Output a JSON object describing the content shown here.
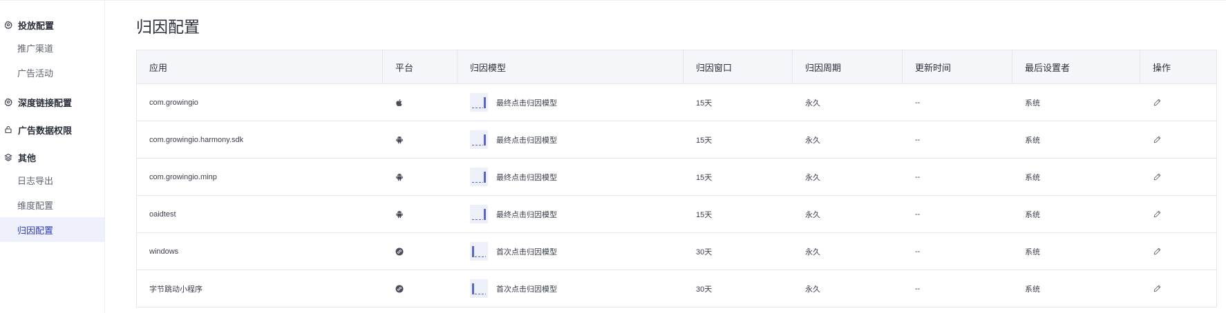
{
  "sidebar": {
    "groups": [
      {
        "icon": "gear-icon",
        "label": "投放配置",
        "items": [
          "推广渠道",
          "广告活动"
        ]
      },
      {
        "icon": "gear-icon",
        "label": "深度链接配置",
        "items": []
      },
      {
        "icon": "lock-icon",
        "label": "广告数据权限",
        "items": []
      },
      {
        "icon": "layers-icon",
        "label": "其他",
        "items": [
          "日志导出",
          "维度配置",
          "归因配置"
        ]
      }
    ],
    "active_item": "归因配置"
  },
  "page": {
    "title": "归因配置"
  },
  "table": {
    "headers": [
      "应用",
      "平台",
      "归因模型",
      "归因窗口",
      "归因周期",
      "更新时间",
      "最后设置者",
      "操作"
    ],
    "rows": [
      {
        "app": "com.growingio",
        "platform": "apple-icon",
        "model": "最终点击归因模型",
        "model_type": "last",
        "window": "15天",
        "period": "永久",
        "updated": "--",
        "setter": "系统"
      },
      {
        "app": "com.growingio.harmony.sdk",
        "platform": "android-icon",
        "model": "最终点击归因模型",
        "model_type": "last",
        "window": "15天",
        "period": "永久",
        "updated": "--",
        "setter": "系统"
      },
      {
        "app": "com.growingio.minp",
        "platform": "android-icon",
        "model": "最终点击归因模型",
        "model_type": "last",
        "window": "15天",
        "period": "永久",
        "updated": "--",
        "setter": "系统"
      },
      {
        "app": "oaidtest",
        "platform": "android-icon",
        "model": "最终点击归因模型",
        "model_type": "last",
        "window": "15天",
        "period": "永久",
        "updated": "--",
        "setter": "系统"
      },
      {
        "app": "windows",
        "platform": "link-icon",
        "model": "首次点击归因模型",
        "model_type": "first",
        "window": "30天",
        "period": "永久",
        "updated": "--",
        "setter": "系统"
      },
      {
        "app": "字节跳动小程序",
        "platform": "link-icon",
        "model": "首次点击归因模型",
        "model_type": "first",
        "window": "30天",
        "period": "永久",
        "updated": "--",
        "setter": "系统"
      }
    ]
  },
  "colors": {
    "accent": "#2f3bb8",
    "model_bar": "#5867c7",
    "active_bg": "#eef1fb"
  }
}
